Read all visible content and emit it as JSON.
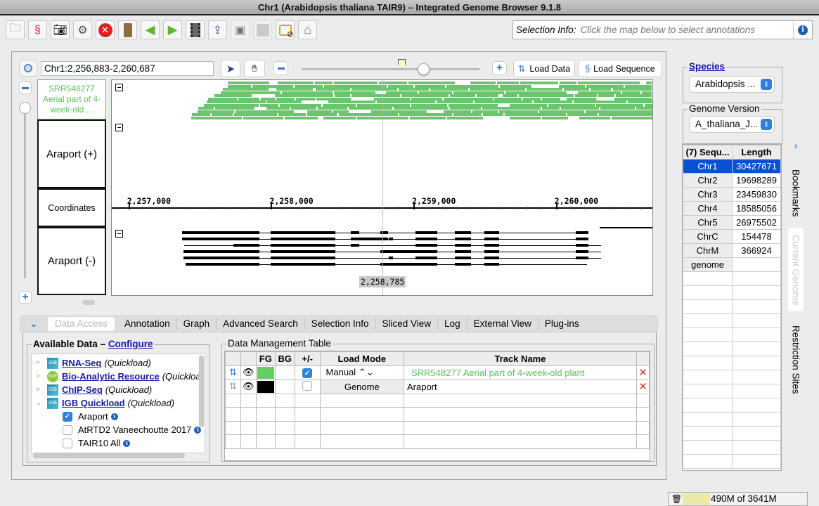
{
  "window": {
    "title": "Chr1  (Arabidopsis thaliana TAIR9) – Integrated Genome Browser 9.1.8"
  },
  "toolbar": {
    "buttons": [
      {
        "name": "open-file",
        "icon": "folder-icon"
      },
      {
        "name": "load-sequence",
        "icon": "dna-icon"
      },
      {
        "name": "snapshot",
        "icon": "camera-icon"
      },
      {
        "name": "preferences",
        "icon": "gear-icon"
      },
      {
        "name": "stop",
        "icon": "stop-icon"
      },
      {
        "name": "bookmarks",
        "icon": "book-icon"
      },
      {
        "name": "back",
        "icon": "arrow-left-icon"
      },
      {
        "name": "forward",
        "icon": "arrow-right-icon"
      },
      {
        "name": "movie",
        "icon": "film-icon"
      },
      {
        "name": "export",
        "icon": "export-icon"
      },
      {
        "name": "disabled-a",
        "icon": "frame-icon"
      },
      {
        "name": "disabled-b",
        "icon": "blank-icon"
      },
      {
        "name": "tooltips-off",
        "icon": "tooltip-off-icon"
      },
      {
        "name": "home",
        "icon": "home-icon"
      }
    ],
    "selection_info_label": "Selection Info:",
    "selection_info_placeholder": "Click the map below to select annotations"
  },
  "navigation": {
    "location": "Chr1:2,256,883-2,260,687",
    "zoom_fraction": 0.68,
    "load_data": "Load Data",
    "load_sequence": "Load Sequence"
  },
  "tracks": {
    "labels": [
      {
        "name": "SRR548277 Aerial part of 4-week-old ...",
        "color": "#5cbf5c"
      },
      {
        "name": "Araport (+)"
      },
      {
        "name": "Coordinates"
      },
      {
        "name": "Araport (-)"
      }
    ],
    "ruler": {
      "start": 2256883,
      "end": 2260687,
      "major_ticks": [
        {
          "pos": 2257000,
          "label": "2,257,000"
        },
        {
          "pos": 2258000,
          "label": "2,258,000"
        },
        {
          "pos": 2259000,
          "label": "2,259,000"
        },
        {
          "pos": 2260000,
          "label": "2,260,000"
        }
      ]
    },
    "cursor_position": "2,258,785",
    "read_color": "#6cc56c"
  },
  "bottom_tabs": [
    "Data Access",
    "Annotation",
    "Graph",
    "Advanced Search",
    "Selection Info",
    "Sliced View",
    "Log",
    "External View",
    "Plug-ins"
  ],
  "available_data": {
    "title": "Available Data – ",
    "configure": "Configure",
    "items": [
      {
        "label": "RNA-Seq",
        "suffix": "(Quickload)",
        "icon": "igb-icon",
        "expanded": false
      },
      {
        "label": "Bio-Analytic Resource",
        "suffix": "(Quickloa",
        "icon": "bar-icon",
        "expanded": false
      },
      {
        "label": "ChIP-Seq",
        "suffix": "(Quickload)",
        "icon": "igb-icon",
        "expanded": false
      },
      {
        "label": "IGB Quickload",
        "suffix": "(Quickload)",
        "icon": "igb-icon",
        "expanded": true
      }
    ],
    "children": [
      {
        "label": "Araport",
        "checked": true
      },
      {
        "label": "AtRTD2 Vaneechoutte 2017",
        "checked": false
      },
      {
        "label": "TAIR10 All",
        "checked": false
      }
    ]
  },
  "data_management": {
    "title": "Data Management Table",
    "columns": [
      "",
      "",
      "FG",
      "BG",
      "+/-",
      "Load Mode",
      "Track Name",
      ""
    ],
    "rows": [
      {
        "fg": "#66cc66",
        "checked": true,
        "load_mode": "Manual ⌃⌄",
        "track": "SRR548277 Aerial part of 4-week-old plant",
        "track_color": "#5cbf5c"
      },
      {
        "fg": "#000000",
        "checked": false,
        "load_mode": "Genome",
        "track": "Araport",
        "track_color": "#000000"
      }
    ]
  },
  "right_panel": {
    "species_label": "Species",
    "species_value": "Arabidopsis ...",
    "genome_label": "Genome Version",
    "genome_value": "A_thaliana_J...",
    "seq_header": "(7) Sequ...",
    "length_header": "Length",
    "sequences": [
      {
        "name": "Chr1",
        "length": "30427671",
        "selected": true
      },
      {
        "name": "Chr2",
        "length": "19698289"
      },
      {
        "name": "Chr3",
        "length": "23459830"
      },
      {
        "name": "Chr4",
        "length": "18585056"
      },
      {
        "name": "Chr5",
        "length": "26975502"
      },
      {
        "name": "ChrC",
        "length": "154478"
      },
      {
        "name": "ChrM",
        "length": "366924"
      },
      {
        "name": "genome",
        "length": ""
      }
    ],
    "side_tabs": [
      "Bookmarks",
      "Current Genome",
      "Restriction Sites"
    ]
  },
  "status": {
    "memory": "490M of 3641M",
    "memory_fraction": 0.13
  }
}
